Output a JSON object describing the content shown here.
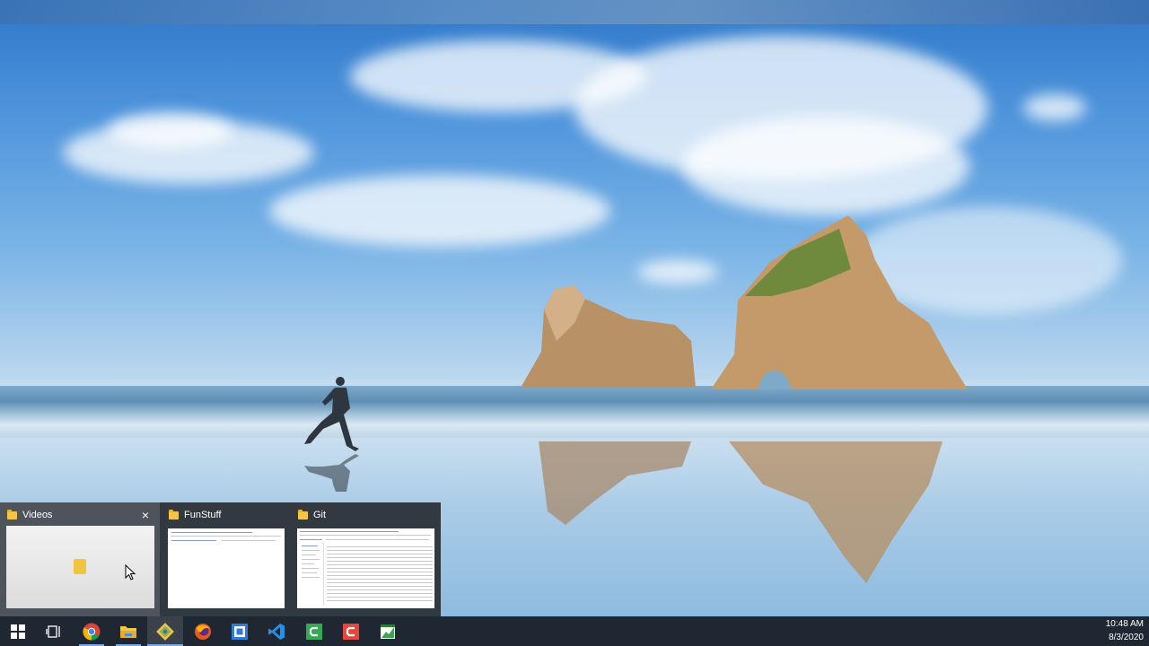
{
  "flyout": {
    "windows": [
      {
        "title": "Videos",
        "has_close": true
      },
      {
        "title": "FunStuff",
        "has_close": false
      },
      {
        "title": "Git",
        "has_close": false
      }
    ],
    "close_symbol": "×"
  },
  "taskbar": {
    "items": [
      {
        "icon": "windows-start-icon"
      },
      {
        "icon": "task-view-icon"
      },
      {
        "icon": "chrome-icon"
      },
      {
        "icon": "file-explorer-icon"
      },
      {
        "icon": "git-icon"
      },
      {
        "icon": "firefox-icon"
      },
      {
        "icon": "app-square-icon"
      },
      {
        "icon": "vscode-icon"
      },
      {
        "icon": "green-c-app-icon"
      },
      {
        "icon": "red-c-app-icon"
      },
      {
        "icon": "spreadsheet-app-icon"
      }
    ],
    "clock": {
      "time": "10:48 AM",
      "date": "8/3/2020"
    }
  },
  "colors": {
    "taskbar": "#1f2733",
    "accent": "#76a9e6",
    "folder": "#f4c54b"
  }
}
